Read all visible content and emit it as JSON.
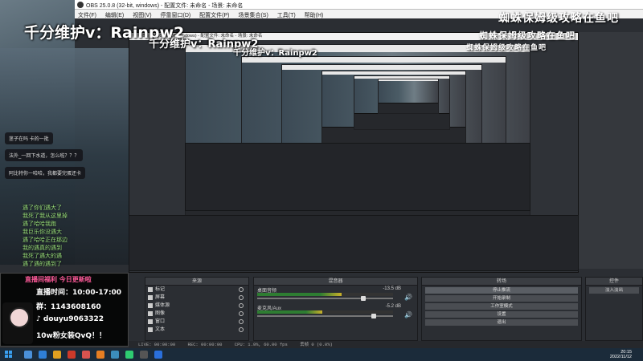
{
  "window": {
    "title": "OBS 25.0.8 (32-bit, windows) - 配置文件: 未命名 - 场景: 未命名",
    "menu": [
      "文件(F)",
      "编辑(E)",
      "视图(V)",
      "停靠窗口(D)",
      "配置文件(P)",
      "场景集合(S)",
      "工具(T)",
      "帮助(H)"
    ]
  },
  "watermarks": {
    "contact_large": "千分维护v：Rainpw2",
    "contact_medium": "千分维护v：Rainpw2",
    "contact_small": "千分维护v：Rainpw2",
    "promo_large": "蜘蛛保姆级攻略在鱼吧",
    "promo_medium": "蜘蛛保姆级攻略在鱼吧",
    "promo_small": "蜘蛛保姆级攻略在鱼吧"
  },
  "chat": {
    "bubbles": [
      "茎子在吗  卡的一批",
      "法外_一回下水道，怎么啦？？？",
      "阿比特你一哈哈，我都要完蛋还卡"
    ],
    "lines": [
      "遇了你们遇大了",
      "我死了我从这里掉",
      "遇了哈哈我跑",
      "我巨乐你没遇大",
      "遇了哈哈正在那边",
      "我的遇真的遇到",
      "我死了遇大的遇",
      "遇了遇的遇到了",
      "遇了哈哈遇了"
    ]
  },
  "promo": {
    "title": "直播间福利  今日更新啦",
    "hours_label": "直播时间",
    "hours_value": "10:00-17:00",
    "group_label": "群",
    "group_value": "1143608160",
    "douyu_label": "douyu9063322",
    "pointer_text": "10w粉女装QvQ！！"
  },
  "docks": {
    "scenes_header": "来源",
    "sources": [
      "标记",
      "屏幕",
      "媒体源",
      "图像",
      "窗口",
      "文本"
    ],
    "mixer_header": "混音器",
    "mixer": [
      {
        "name": "桌面音频",
        "db": "-13.5 dB",
        "level": 0.62,
        "volume": 0.78
      },
      {
        "name": "麦克风/Aux",
        "db": "-5.2 dB",
        "level": 0.48,
        "volume": 0.86
      }
    ],
    "transitions_header": "转场",
    "controls_header": "控件",
    "controls": [
      "停止推流",
      "开始录制",
      "工作室模式",
      "设置",
      "退出"
    ],
    "scene_transition_label": "淡入淡出"
  },
  "status": {
    "live": "LIVE: 00:00:00",
    "rec": "REC: 00:00:00",
    "cpu": "CPU: 1.9%, 60.00 fps",
    "dropped": "丢帧 0 (0.0%)"
  },
  "taskbar": {
    "time": "20:15",
    "date": "2022/11/12"
  },
  "colors": {
    "accent": "#ff5a9a",
    "meter_green": "#2e7d32",
    "meter_yellow": "#c9b02a",
    "meter_red": "#b3362b"
  }
}
